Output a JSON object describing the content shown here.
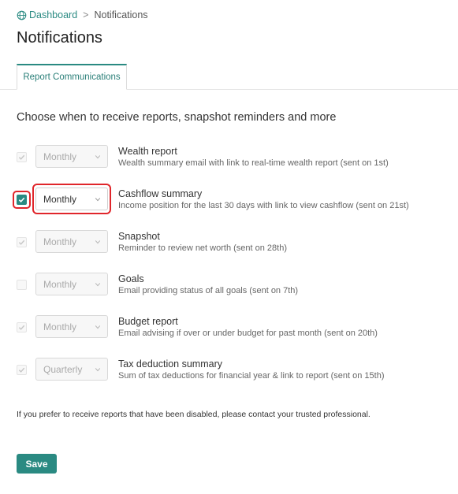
{
  "breadcrumb": {
    "home_label": "Dashboard",
    "separator": ">",
    "current_label": "Notifications"
  },
  "page": {
    "title": "Notifications",
    "subtitle": "Choose when to receive reports, snapshot reminders and more",
    "footer_note": "If you prefer to receive reports that have been disabled, please contact your trusted professional."
  },
  "tabs": [
    {
      "label": "Report Communications",
      "active": true
    }
  ],
  "reports": [
    {
      "checked": true,
      "enabled": false,
      "frequency": "Monthly",
      "title": "Wealth report",
      "description": "Wealth summary email with link to real-time wealth report (sent on 1st)"
    },
    {
      "checked": true,
      "enabled": true,
      "frequency": "Monthly",
      "title": "Cashflow summary",
      "description": "Income position for the last 30 days with link to view cashflow (sent on 21st)"
    },
    {
      "checked": true,
      "enabled": false,
      "frequency": "Monthly",
      "title": "Snapshot",
      "description": "Reminder to review net worth (sent on 28th)"
    },
    {
      "checked": false,
      "enabled": false,
      "frequency": "Monthly",
      "title": "Goals",
      "description": "Email providing status of all goals (sent on 7th)"
    },
    {
      "checked": true,
      "enabled": false,
      "frequency": "Monthly",
      "title": "Budget report",
      "description": "Email advising if over or under budget for past month (sent on 20th)"
    },
    {
      "checked": true,
      "enabled": false,
      "frequency": "Quarterly",
      "title": "Tax deduction summary",
      "description": "Sum of tax deductions for financial year & link to report (sent on 15th)"
    }
  ],
  "buttons": {
    "save_label": "Save"
  },
  "colors": {
    "accent": "#2a8a82",
    "highlight": "#e0262b"
  }
}
